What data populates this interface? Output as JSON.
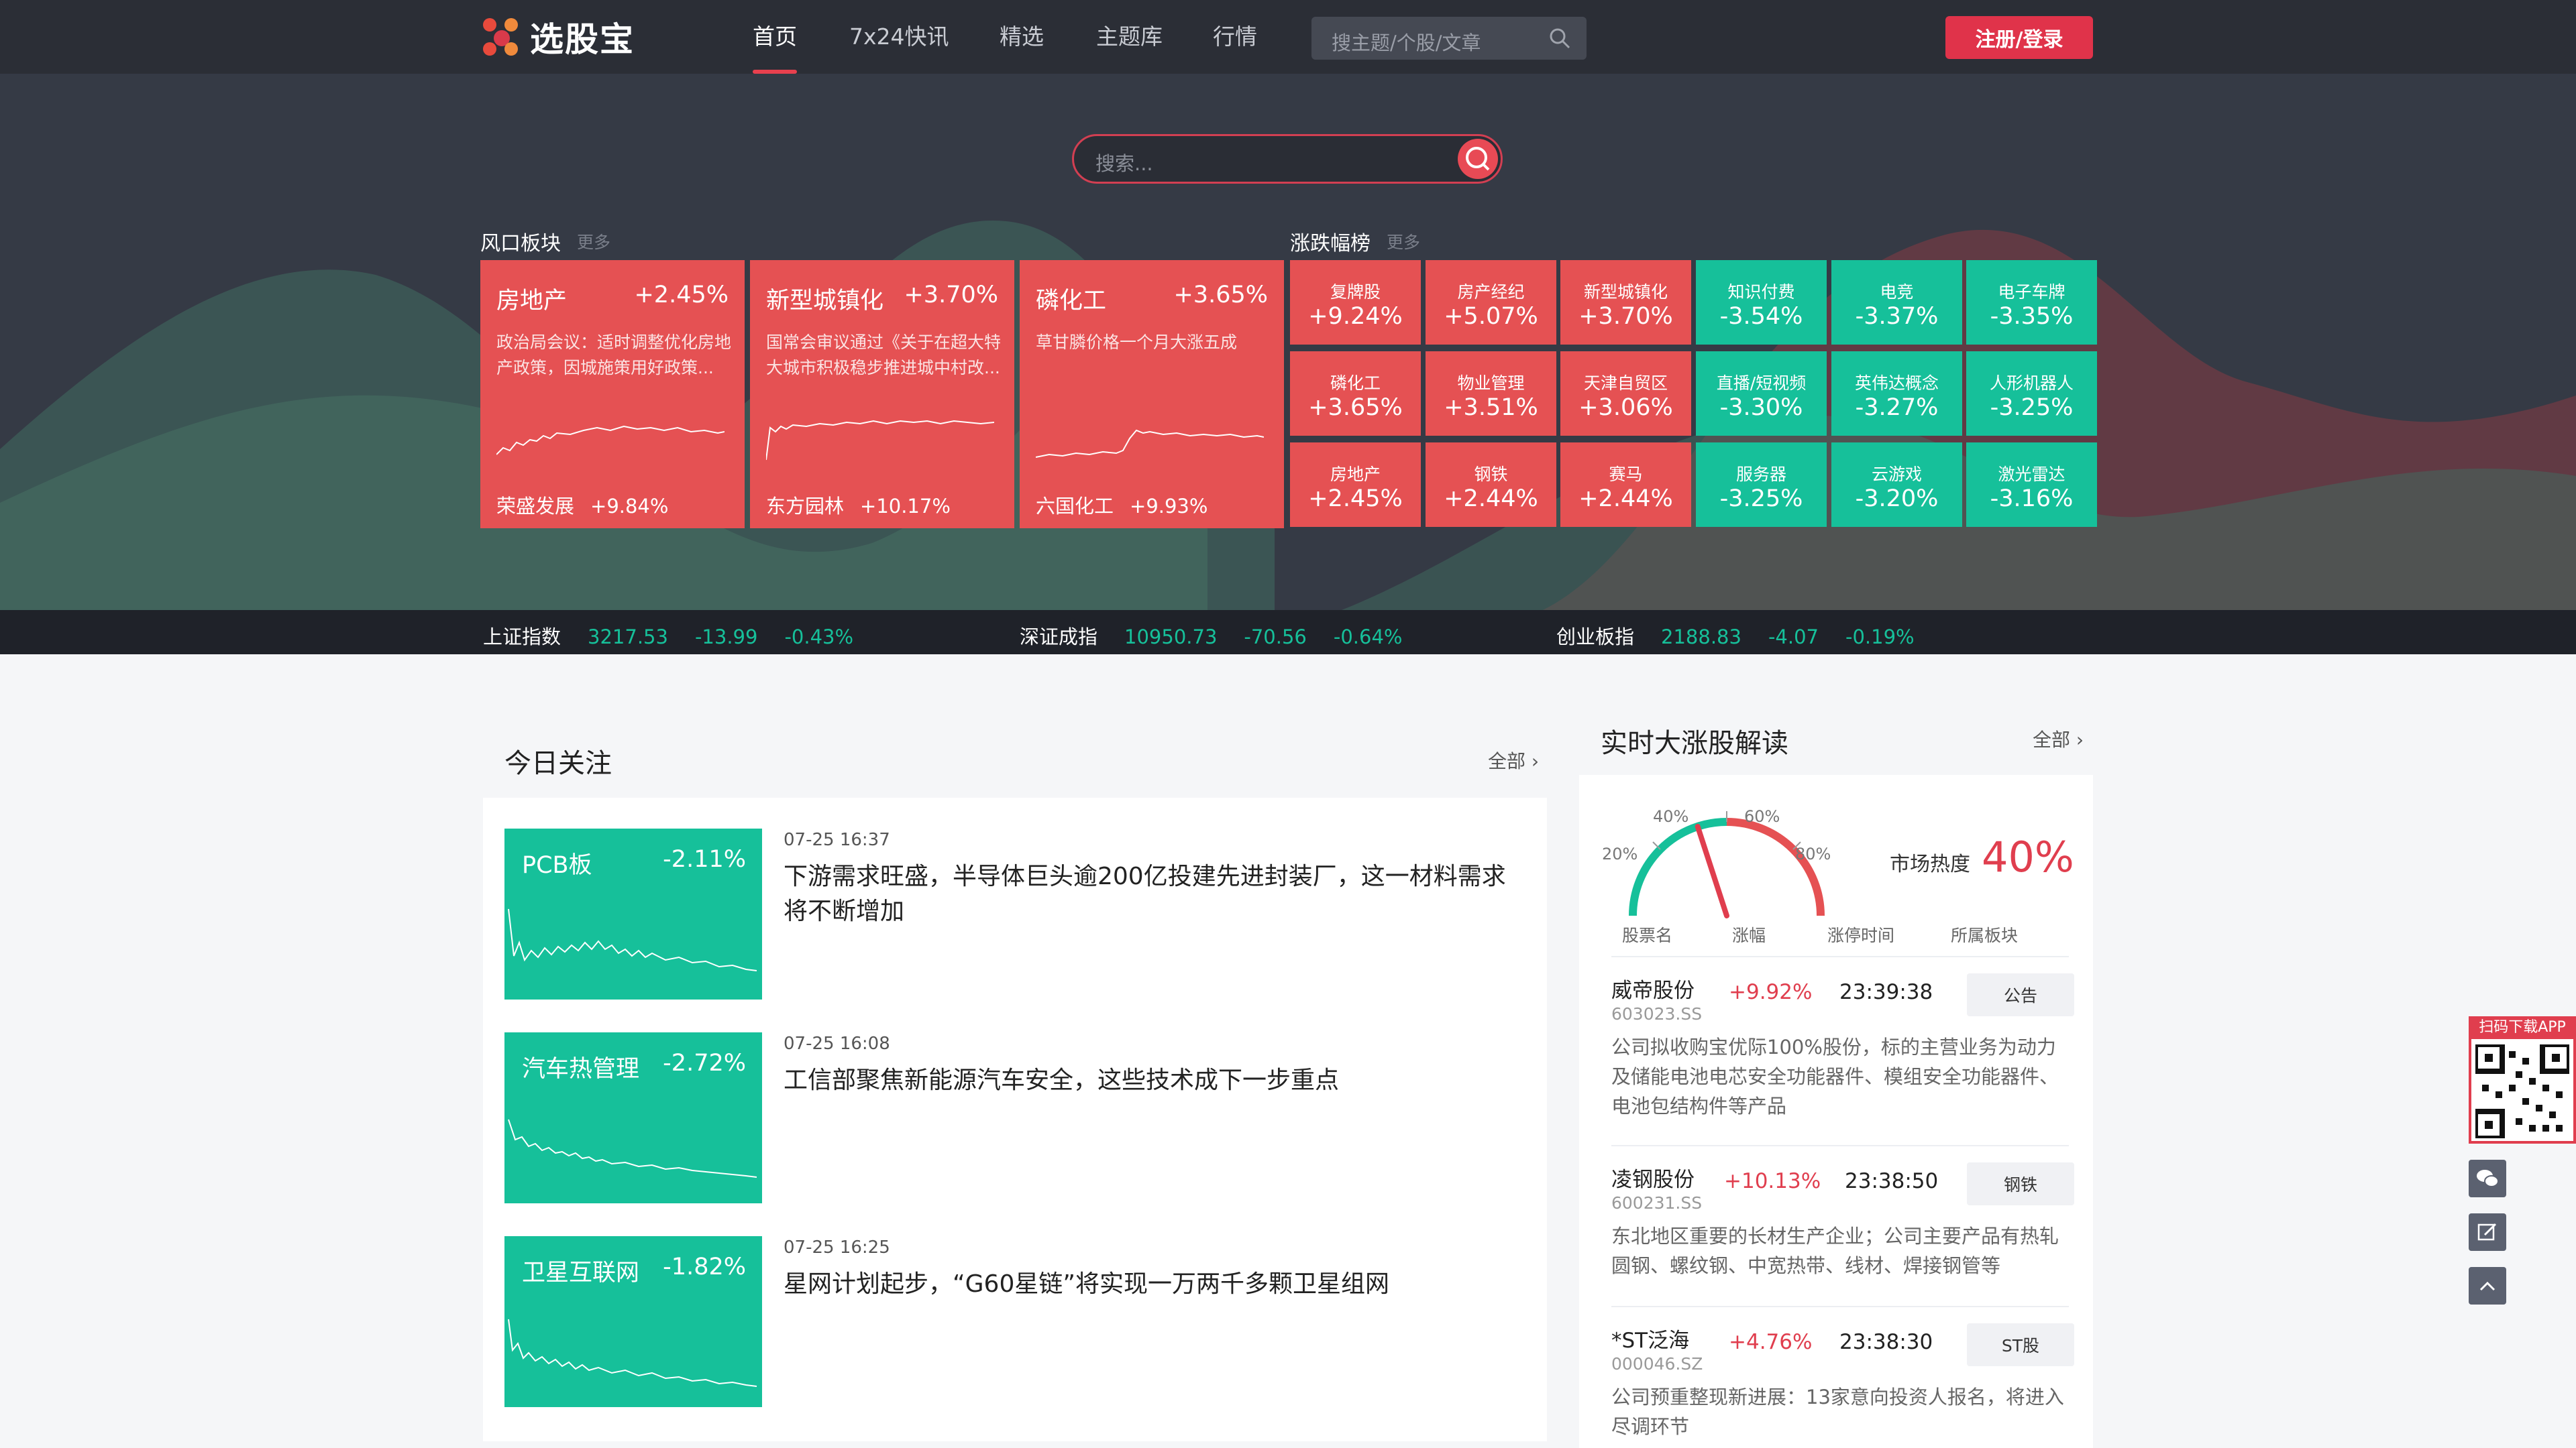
{
  "nav": {
    "logo_text": "选股宝",
    "items": [
      {
        "label": "首页",
        "active": true
      },
      {
        "label": "7x24快讯",
        "active": false
      },
      {
        "label": "精选",
        "active": false
      },
      {
        "label": "主题库",
        "active": false
      },
      {
        "label": "行情",
        "active": false
      }
    ],
    "search_placeholder": "搜主题/个股/文章",
    "login_label": "注册/登录"
  },
  "hero": {
    "search_placeholder": "搜索..."
  },
  "wind": {
    "title": "风口板块",
    "more": "更多",
    "cards": [
      {
        "name": "房地产",
        "pct": "+2.45%",
        "desc": "政治局会议：适时调整优化房地产政策，因城施策用好政策...",
        "stock": "荣盛发展",
        "stock_pct": "+9.84%"
      },
      {
        "name": "新型城镇化",
        "pct": "+3.70%",
        "desc": "国常会审议通过《关于在超大特大城市积极稳步推进城中村改...",
        "stock": "东方园林",
        "stock_pct": "+10.17%"
      },
      {
        "name": "磷化工",
        "pct": "+3.65%",
        "desc": "草甘膦价格一个月大涨五成",
        "stock": "六国化工",
        "stock_pct": "+9.93%"
      }
    ]
  },
  "movers": {
    "title": "涨跌幅榜",
    "more": "更多",
    "up": [
      {
        "name": "复牌股",
        "pct": "+9.24%"
      },
      {
        "name": "房产经纪",
        "pct": "+5.07%"
      },
      {
        "name": "新型城镇化",
        "pct": "+3.70%"
      },
      {
        "name": "磷化工",
        "pct": "+3.65%"
      },
      {
        "name": "物业管理",
        "pct": "+3.51%"
      },
      {
        "name": "天津自贸区",
        "pct": "+3.06%"
      },
      {
        "name": "房地产",
        "pct": "+2.45%"
      },
      {
        "name": "钢铁",
        "pct": "+2.44%"
      },
      {
        "name": "赛马",
        "pct": "+2.44%"
      }
    ],
    "down": [
      {
        "name": "知识付费",
        "pct": "-3.54%"
      },
      {
        "name": "电竞",
        "pct": "-3.37%"
      },
      {
        "name": "电子车牌",
        "pct": "-3.35%"
      },
      {
        "name": "直播/短视频",
        "pct": "-3.30%"
      },
      {
        "name": "英伟达概念",
        "pct": "-3.27%"
      },
      {
        "name": "人形机器人",
        "pct": "-3.25%"
      },
      {
        "name": "服务器",
        "pct": "-3.25%"
      },
      {
        "name": "云游戏",
        "pct": "-3.20%"
      },
      {
        "name": "激光雷达",
        "pct": "-3.16%"
      }
    ]
  },
  "indices": [
    {
      "name": "上证指数",
      "value": "3217.53",
      "change": "-13.99",
      "pct": "-0.43%"
    },
    {
      "name": "深证成指",
      "value": "10950.73",
      "change": "-70.56",
      "pct": "-0.64%"
    },
    {
      "name": "创业板指",
      "value": "2188.83",
      "change": "-4.07",
      "pct": "-0.19%"
    }
  ],
  "focus": {
    "title": "今日关注",
    "all": "全部",
    "items": [
      {
        "sector": "PCB板",
        "pct": "-2.11%",
        "time": "07-25 16:37",
        "headline": "下游需求旺盛，半导体巨头逾200亿投建先进封装厂，这一材料需求将不断增加"
      },
      {
        "sector": "汽车热管理",
        "pct": "-2.72%",
        "time": "07-25 16:08",
        "headline": "工信部聚焦新能源汽车安全，这些技术成下一步重点"
      },
      {
        "sector": "卫星互联网",
        "pct": "-1.82%",
        "time": "07-25 16:25",
        "headline": "星网计划起步，“G60星链”将实现一万两千多颗卫星组网"
      }
    ]
  },
  "realtime": {
    "title": "实时大涨股解读",
    "all": "全部",
    "gauge_labels": [
      "20%",
      "40%",
      "60%",
      "80%"
    ],
    "heat_label": "市场热度",
    "heat_value": "40%",
    "heat_fraction": 0.4,
    "columns": [
      "股票名",
      "涨幅",
      "涨停时间",
      "所属板块"
    ],
    "rows": [
      {
        "name": "威帝股份",
        "code": "603023.SS",
        "pct": "+9.92%",
        "time": "23:39:38",
        "tag": "公告",
        "desc": "公司拟收购宝优际100%股份，标的主营业务为动力及储能电池电芯安全功能器件、模组安全功能器件、电池包结构件等产品"
      },
      {
        "name": "凌钢股份",
        "code": "600231.SS",
        "pct": "+10.13%",
        "time": "23:38:50",
        "tag": "钢铁",
        "desc": "东北地区重要的长材生产企业；公司主要产品有热轧圆钢、螺纹钢、中宽热带、线材、焊接钢管等"
      },
      {
        "name": "*ST泛海",
        "code": "000046.SZ",
        "pct": "+4.76%",
        "time": "23:38:30",
        "tag": "ST股",
        "desc": "公司预重整现新进展：13家意向投资人报名，将进入尽调环节"
      }
    ]
  },
  "side": {
    "qr_title": "扫码下载APP"
  },
  "colors": {
    "up": "#e55153",
    "down": "#16c09a",
    "accent": "#e0334a",
    "nav_bg": "#2b2e36"
  }
}
